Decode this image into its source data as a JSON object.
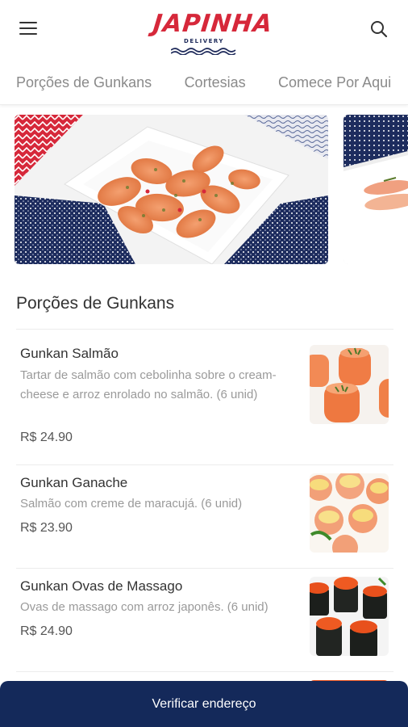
{
  "header": {
    "logo_text": "JAPINHA",
    "logo_sub": "DELIVERY",
    "menu_icon": "hamburger-menu-icon",
    "search_icon": "search-icon",
    "brand_red": "#d6283a",
    "brand_navy": "#1e2a5a"
  },
  "tabs": [
    {
      "label": "Porções de Gunkans"
    },
    {
      "label": "Cortesias"
    },
    {
      "label": "Comece Por Aqui"
    }
  ],
  "section": {
    "title": "Porções de Gunkans",
    "items": [
      {
        "name": "Gunkan Salmão",
        "description": "Tartar de salmão com cebolinha sobre o cream-cheese e arroz enrolado no salmão. (6 unid)",
        "price": "R$ 24.90"
      },
      {
        "name": "Gunkan Ganache",
        "description": "Salmão com creme de maracujá. (6 unid)",
        "price": "R$ 23.90"
      },
      {
        "name": "Gunkan Ovas de Massago",
        "description": "Ovas de massago com arroz japonês. (6 unid)",
        "price": "R$ 24.90"
      }
    ]
  },
  "cta": {
    "label": "Verificar endereço",
    "color": "#14295a"
  }
}
